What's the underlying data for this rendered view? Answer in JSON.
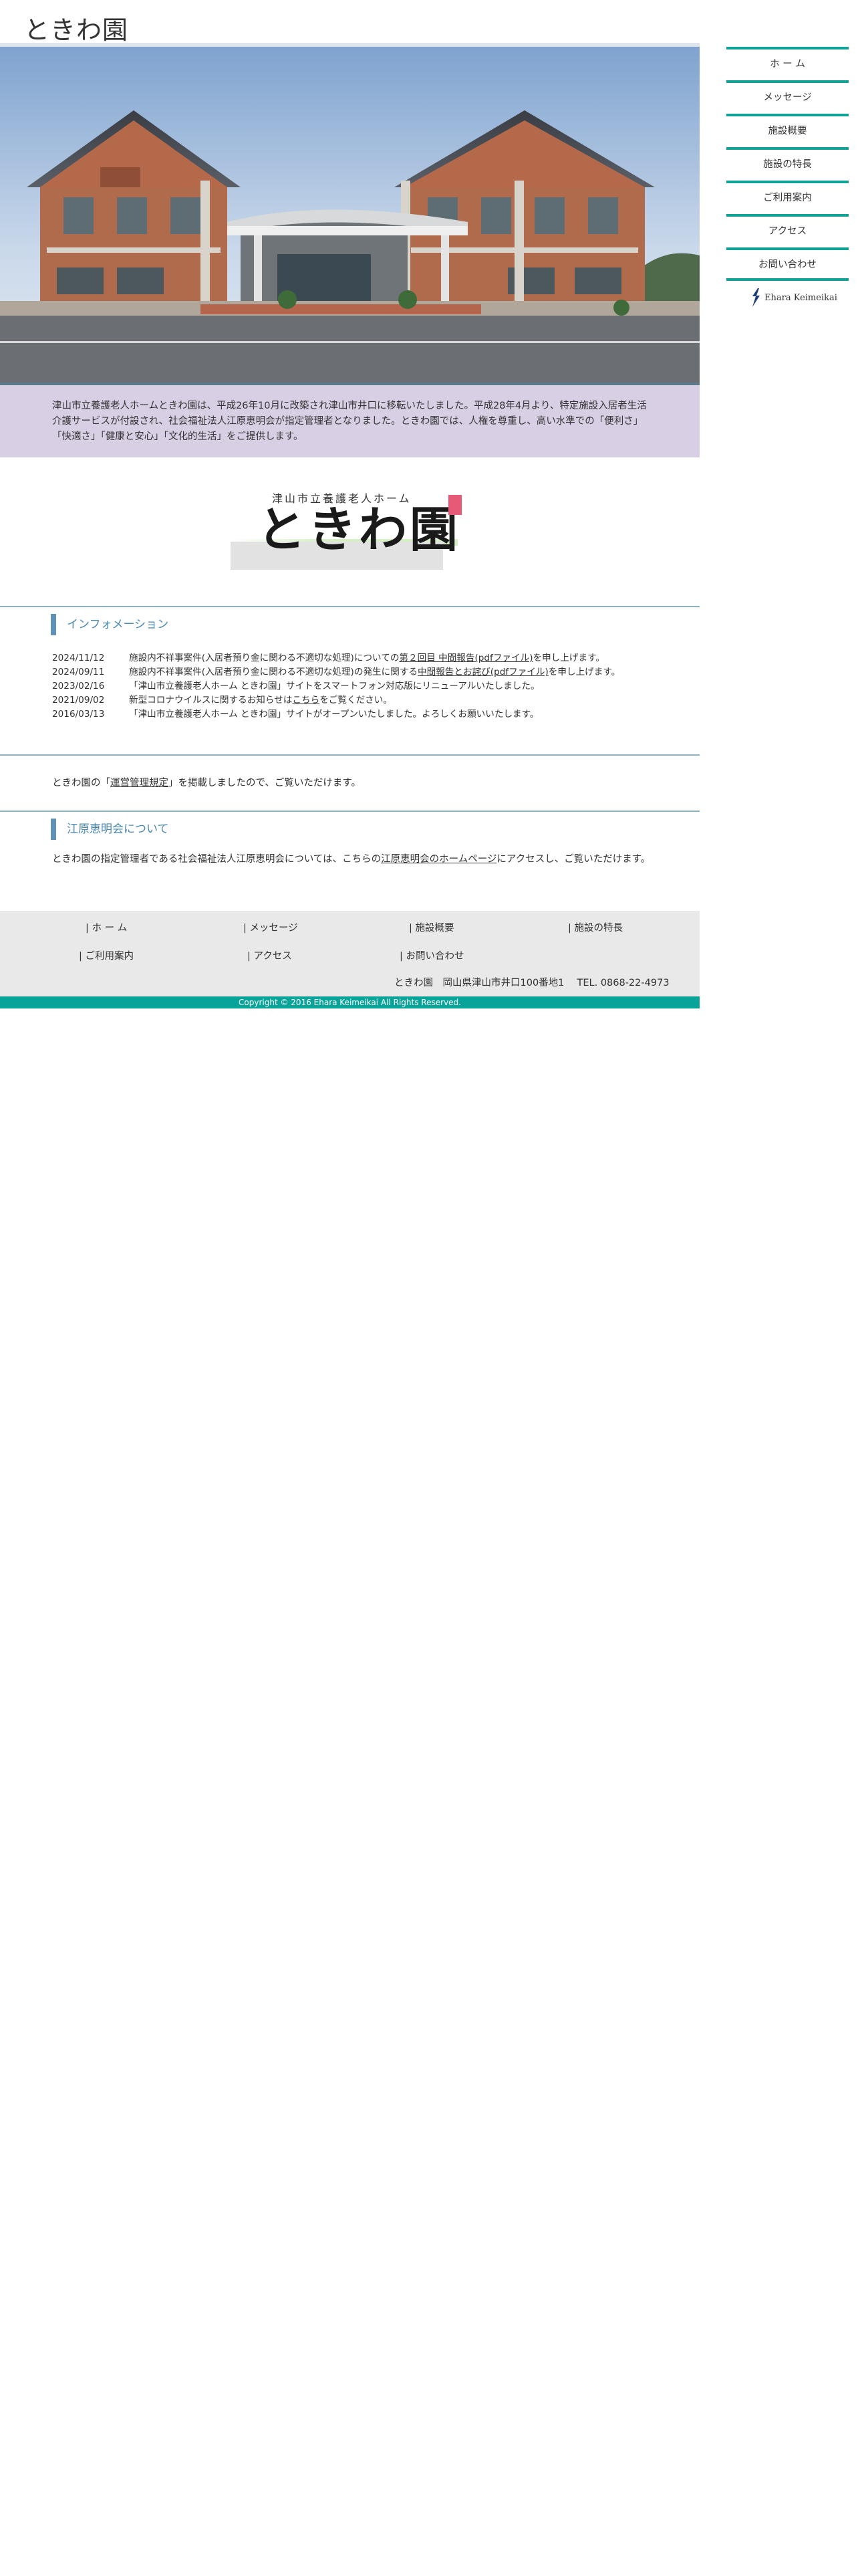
{
  "site": {
    "title": "ときわ園"
  },
  "intro": {
    "text": "津山市立養護老人ホームときわ園は、平成26年10月に改築され津山市井口に移転いたしました。平成28年4月より、特定施設入居者生活介護サービスが付設され、社会福祉法人江原恵明会が指定管理者となりました。ときわ園では、人権を尊重し、高い水準での「便利さ」「快適さ」「健康と安心」「文化的生活」をご提供します。"
  },
  "logo": {
    "subtitle": "津山市立養護老人ホーム",
    "name": "ときわ園"
  },
  "information": {
    "heading": "インフォメーション",
    "items": [
      {
        "date": "2024/11/12",
        "text_before": "施設内不祥事案件(入居者預り金に関わる不適切な処理)についての",
        "link": "第２回目 中間報告(pdfファイル)",
        "text_after": "を申し上げます。"
      },
      {
        "date": "2024/09/11",
        "text_before": "施設内不祥事案件(入居者預り金に関わる不適切な処理)の発生に関する",
        "link": "中間報告とお詫び(pdfファイル)",
        "text_after": "を申し上げます。"
      },
      {
        "date": "2023/02/16",
        "text_before": "「津山市立養護老人ホーム ときわ園」サイトをスマートフォン対応版にリニューアルいたしました。",
        "link": "",
        "text_after": ""
      },
      {
        "date": "2021/09/02",
        "text_before": "新型コロナウイルスに関するお知らせは",
        "link": "こちら",
        "text_after": "をご覧ください。"
      },
      {
        "date": "2016/03/13",
        "text_before": "「津山市立養護老人ホーム ときわ園」サイトがオープンいたしました。よろしくお願いいたします。",
        "link": "",
        "text_after": ""
      }
    ]
  },
  "regulation": {
    "before": "ときわ園の「",
    "link": "運営管理規定",
    "after": "」を掲載しましたので、ご覧いただけます。"
  },
  "ehara": {
    "heading": "江原恵明会について",
    "before": "ときわ園の指定管理者である社会福祉法人江原恵明会については、こちらの",
    "link": "江原恵明会のホームページ",
    "after": "にアクセスし、ご覧いただけます。"
  },
  "footer": {
    "nav": [
      "| ホ ー ム",
      "| メッセージ",
      "| 施設概要",
      "| 施設の特長",
      "| ご利用案内",
      "| アクセス",
      "| お問い合わせ"
    ],
    "address": "ときわ園　岡山県津山市井口100番地1　 TEL. 0868-22-4973",
    "copyright": "Copyright © 2016 Ehara Keimeikai All Rights Reserved."
  },
  "sidenav": {
    "items": [
      "ホ ー ム",
      "メッセージ",
      "施設概要",
      "施設の特長",
      "ご利用案内",
      "アクセス",
      "お問い合わせ"
    ],
    "partner_logo_text": "Ehara  Keimeikai"
  },
  "colors": {
    "accent_teal": "#12a294",
    "intro_band": "#d8cfe4",
    "heading_blue": "#4a89b2",
    "copyright_bar": "#0aa39a"
  }
}
